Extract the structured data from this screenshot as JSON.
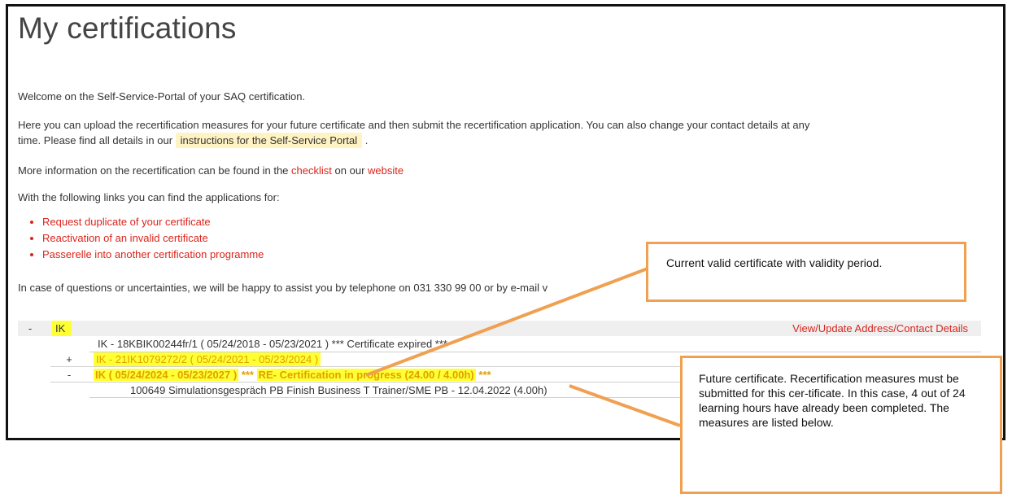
{
  "page": {
    "title": "My certifications",
    "welcome": "Welcome on the Self-Service-Portal of your SAQ certification.",
    "intro_part1": "Here you can upload the recertification measures for your future certificate and then submit the recertification application. You can also change your contact details at any",
    "intro_part2": "time. Please find all details in our",
    "instructions_link": "instructions for the Self-Service Portal",
    "intro_end": ".",
    "more_info_prefix": "More information on the recertification can be found in the",
    "checklist_link": "checklist",
    "more_info_mid": "on our",
    "website_link": "website",
    "links_intro": "With the following links you can find the applications for:",
    "applications": [
      "Request duplicate of your certificate",
      "Reactivation of an invalid certificate",
      "Passerelle into another certification programme"
    ],
    "contact_text": "In case of questions or uncertainties, we will be happy to assist you by telephone on 031 330 99 00 or by e-mail v"
  },
  "tree": {
    "root_sign": "-",
    "root_label": "IK",
    "update_link": "View/Update Address/Contact Details",
    "expired_cert": "IK - 18KBIK00244fr/1 ( 05/24/2018 - 05/23/2021 ) *** Certificate expired ***",
    "current_sign": "+",
    "current_cert": "IK - 21IK1079272/2 ( 05/24/2021 - 05/23/2024 )",
    "future_sign": "-",
    "future_cert": "IK ( 05/24/2024 - 05/23/2027 )",
    "future_stars1": "***",
    "future_status": "RE- Certification in progress (24.00 / 4.00h)",
    "future_stars2": "***",
    "measure": "100649 Simulationsgespräch PB Finish Business T Trainer/SME PB - 12.04.2022 (4.00h)"
  },
  "callouts": {
    "current": "Current valid certificate with validity period.",
    "future": "Future certificate. Recertification measures must be submitted for this cer-tificate. In this case, 4 out of 24 learning hours have already been completed. The measures are listed below."
  },
  "colors": {
    "link": "#d9251c",
    "highlight": "#ffff33",
    "callout_border": "#f0a050"
  }
}
